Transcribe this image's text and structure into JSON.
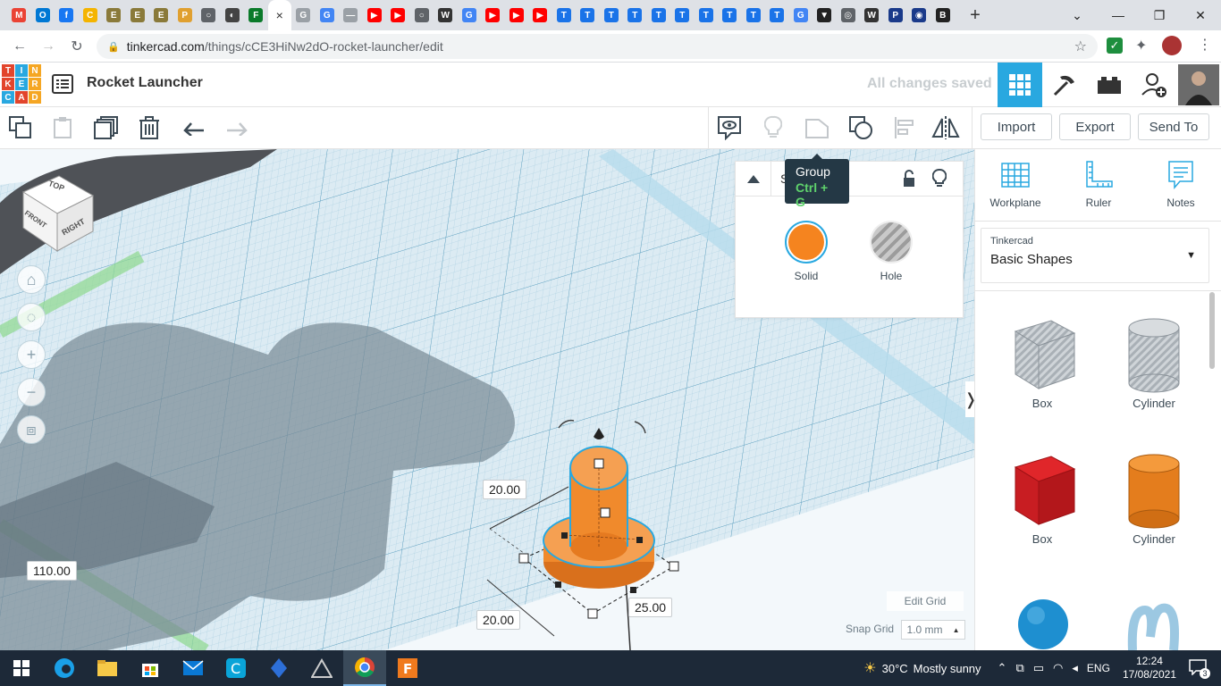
{
  "browser": {
    "url_domain": "tinkercad.com",
    "url_path": "/things/cCE3HiNw2dO-rocket-launcher/edit",
    "new_tab": "+",
    "tabs": [
      {
        "icon": "gmail-icon",
        "color": "#ea4335",
        "glyph": "M"
      },
      {
        "icon": "outlook-icon",
        "color": "#0078d4",
        "glyph": "O"
      },
      {
        "icon": "facebook-icon",
        "color": "#1877f2",
        "glyph": "f"
      },
      {
        "icon": "c-icon",
        "color": "#f4b400",
        "glyph": "C"
      },
      {
        "icon": "emblem-icon",
        "color": "#8a7a3a",
        "glyph": "E"
      },
      {
        "icon": "emblem-icon",
        "color": "#8a7a3a",
        "glyph": "E"
      },
      {
        "icon": "emblem-icon",
        "color": "#8a7a3a",
        "glyph": "E"
      },
      {
        "icon": "person-icon",
        "color": "#e0a030",
        "glyph": "P"
      },
      {
        "icon": "globe-icon",
        "color": "#5f6368",
        "glyph": "○"
      },
      {
        "icon": "shield-icon",
        "color": "#444",
        "glyph": "◐"
      },
      {
        "icon": "f-icon",
        "color": "#0a7a2a",
        "glyph": "F"
      },
      {
        "icon": "close-tab-icon",
        "color": "",
        "glyph": "×",
        "active": true
      },
      {
        "icon": "translate-icon",
        "color": "#9aa0a6",
        "glyph": "G"
      },
      {
        "icon": "google-icon",
        "color": "#4285f4",
        "glyph": "G"
      },
      {
        "icon": "line-icon",
        "color": "#9aa0a6",
        "glyph": "—"
      },
      {
        "icon": "youtube-icon",
        "color": "#ff0000",
        "glyph": "▶"
      },
      {
        "icon": "youtube-icon",
        "color": "#ff0000",
        "glyph": "▶"
      },
      {
        "icon": "globe-icon",
        "color": "#5f6368",
        "glyph": "○"
      },
      {
        "icon": "wikipedia-icon",
        "color": "#333",
        "glyph": "W"
      },
      {
        "icon": "google-icon",
        "color": "#4285f4",
        "glyph": "G"
      },
      {
        "icon": "youtube-icon",
        "color": "#ff0000",
        "glyph": "▶"
      },
      {
        "icon": "youtube-icon",
        "color": "#ff0000",
        "glyph": "▶"
      },
      {
        "icon": "youtube-icon",
        "color": "#ff0000",
        "glyph": "▶"
      },
      {
        "icon": "t-icon",
        "color": "#1a73e8",
        "glyph": "T"
      },
      {
        "icon": "t-icon",
        "color": "#1a73e8",
        "glyph": "T"
      },
      {
        "icon": "t-icon",
        "color": "#1a73e8",
        "glyph": "T"
      },
      {
        "icon": "t-icon",
        "color": "#1a73e8",
        "glyph": "T"
      },
      {
        "icon": "t-icon",
        "color": "#1a73e8",
        "glyph": "T"
      },
      {
        "icon": "t-icon",
        "color": "#1a73e8",
        "glyph": "T"
      },
      {
        "icon": "t-icon",
        "color": "#1a73e8",
        "glyph": "T"
      },
      {
        "icon": "t-icon",
        "color": "#1a73e8",
        "glyph": "T"
      },
      {
        "icon": "t-icon",
        "color": "#1a73e8",
        "glyph": "T"
      },
      {
        "icon": "t-icon",
        "color": "#1a73e8",
        "glyph": "T"
      },
      {
        "icon": "google-icon",
        "color": "#4285f4",
        "glyph": "G"
      },
      {
        "icon": "v-icon",
        "color": "#222",
        "glyph": "▼"
      },
      {
        "icon": "chrome-icon",
        "color": "#5f6368",
        "glyph": "◎"
      },
      {
        "icon": "wikipedia-icon",
        "color": "#333",
        "glyph": "W"
      },
      {
        "icon": "p21-icon",
        "color": "#1a3a8a",
        "glyph": "P"
      },
      {
        "icon": "eye-icon",
        "color": "#1a3a8a",
        "glyph": "◉"
      },
      {
        "icon": "bbc-icon",
        "color": "#222",
        "glyph": "B"
      }
    ]
  },
  "app": {
    "logo_letters": [
      "T",
      "I",
      "N",
      "K",
      "E",
      "R",
      "C",
      "A",
      "D"
    ],
    "logo_colors": [
      "#e2452c",
      "#29a8e0",
      "#f5a623",
      "#e2452c",
      "#29a8e0",
      "#f5a623",
      "#29a8e0",
      "#e2452c",
      "#f5a623"
    ],
    "title": "Rocket Launcher",
    "save_status": "All changes saved"
  },
  "toolbar": {
    "import": "Import",
    "export": "Export",
    "send_to": "Send To"
  },
  "tooltip": {
    "title": "Group",
    "shortcut": "Ctrl + G"
  },
  "inspector": {
    "header": "Sha",
    "solid_label": "Solid",
    "hole_label": "Hole",
    "solid_color": "#f5841f"
  },
  "view_cube": {
    "top": "TOP",
    "front": "FRONT",
    "right": "RIGHT"
  },
  "workplane": {
    "dim_20_top": "20.00",
    "dim_20_bottom": "20.00",
    "dim_25": "25.00",
    "dim_110": "110.00",
    "edit_grid": "Edit Grid",
    "snap_grid_label": "Snap Grid",
    "snap_grid_value": "1.0 mm",
    "snap_arrow": "▲",
    "accent": "#29a8e0"
  },
  "right_panel": {
    "tools": [
      "Workplane",
      "Ruler",
      "Notes"
    ],
    "library_source": "Tinkercad",
    "library_name": "Basic Shapes",
    "shapes": [
      {
        "label": "Box",
        "style": "hole"
      },
      {
        "label": "Cylinder",
        "style": "hole"
      },
      {
        "label": "Box",
        "style": "red"
      },
      {
        "label": "Cylinder",
        "style": "orange"
      }
    ]
  },
  "taskbar": {
    "temperature": "30°C",
    "weather": "Mostly sunny",
    "language": "ENG",
    "time": "12:24",
    "date": "17/08/2021",
    "notifications": "3"
  }
}
